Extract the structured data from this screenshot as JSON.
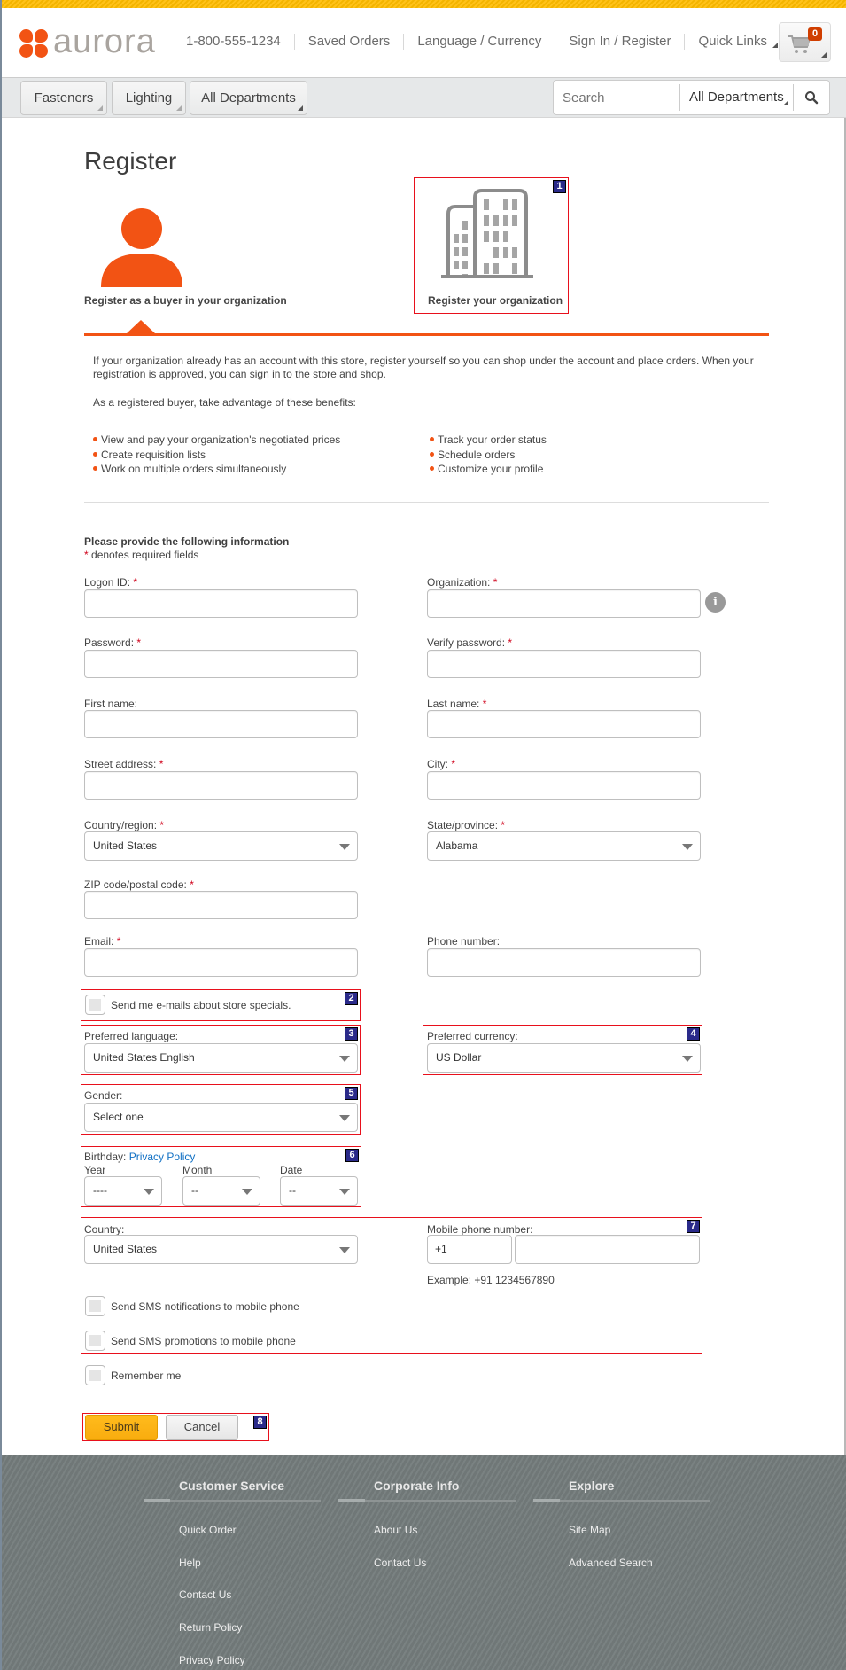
{
  "header": {
    "logo_text": "aurora",
    "links": [
      "1-800-555-1234",
      "Saved Orders",
      "Language / Currency",
      "Sign In / Register",
      "Quick Links"
    ],
    "cart_count": "0",
    "brand_color": "#f25314",
    "accent_color": "#ffbb1c"
  },
  "nav": {
    "departments": [
      "Fasteners",
      "Lighting",
      "All Departments"
    ],
    "search_placeholder": "Search",
    "search_department": "All Departments"
  },
  "page": {
    "title": "Register",
    "options": [
      {
        "label": "Register as a buyer in your organization",
        "icon": "person-icon",
        "selected": true
      },
      {
        "label": "Register your organization",
        "icon": "building-icon",
        "selected": false
      }
    ],
    "description": "If your organization already has an account with this store, register yourself so you can shop under the account and place orders. When your registration is approved, you can sign in to the store and shop.",
    "benefits_intro": "As a registered buyer, take advantage of these benefits:",
    "benefits_left": [
      "View and pay your organization's negotiated prices",
      "Create requisition lists",
      "Work on multiple orders simultaneously"
    ],
    "benefits_right": [
      "Track your order status",
      "Schedule orders",
      "Customize your profile"
    ]
  },
  "form": {
    "intro_title": "Please provide the following information",
    "required_note": "denotes required fields",
    "required_mark": "*",
    "fields": {
      "logon_id": {
        "label": "Logon ID:",
        "value": ""
      },
      "organization": {
        "label": "Organization:",
        "value": ""
      },
      "password": {
        "label": "Password:",
        "value": ""
      },
      "verify_password": {
        "label": "Verify password:",
        "value": ""
      },
      "first_name": {
        "label": "First name:",
        "value": ""
      },
      "last_name": {
        "label": "Last name:",
        "value": ""
      },
      "street_address": {
        "label": "Street address:",
        "value": ""
      },
      "city": {
        "label": "City:",
        "value": ""
      },
      "country_region": {
        "label": "Country/region:",
        "value": "United States"
      },
      "state_province": {
        "label": "State/province:",
        "value": "Alabama"
      },
      "zip": {
        "label": "ZIP code/postal code:",
        "value": ""
      },
      "email": {
        "label": "Email:",
        "value": ""
      },
      "phone": {
        "label": "Phone number:",
        "value": ""
      }
    },
    "email_specials": "Send me e-mails about store specials.",
    "preferred_language": {
      "label": "Preferred language:",
      "value": "United States English"
    },
    "preferred_currency": {
      "label": "Preferred currency:",
      "value": "US Dollar"
    },
    "gender": {
      "label": "Gender:",
      "value": "Select one"
    },
    "birthday": {
      "label": "Birthday:",
      "privacy_link": "Privacy Policy",
      "year_label": "Year",
      "year_value": "----",
      "month_label": "Month",
      "month_value": "--",
      "date_label": "Date",
      "date_value": "--"
    },
    "mobile": {
      "country_label": "Country:",
      "country_value": "United States",
      "phone_label": "Mobile phone number:",
      "country_code": "+1",
      "phone_value": "",
      "example": "Example: +91 1234567890",
      "sms_notifications": "Send SMS notifications to mobile phone",
      "sms_promotions": "Send SMS promotions to mobile phone"
    },
    "remember_me": "Remember me",
    "submit_label": "Submit",
    "cancel_label": "Cancel"
  },
  "annotations": [
    "1",
    "2",
    "3",
    "4",
    "5",
    "6",
    "7",
    "8"
  ],
  "footer": {
    "columns": [
      {
        "title": "Customer Service",
        "links": [
          "Quick Order",
          "Help",
          "Contact Us",
          "Return Policy",
          "Privacy Policy"
        ]
      },
      {
        "title": "Corporate Info",
        "links": [
          "About Us",
          "Contact Us"
        ]
      },
      {
        "title": "Explore",
        "links": [
          "Site Map",
          "Advanced Search"
        ]
      }
    ]
  }
}
